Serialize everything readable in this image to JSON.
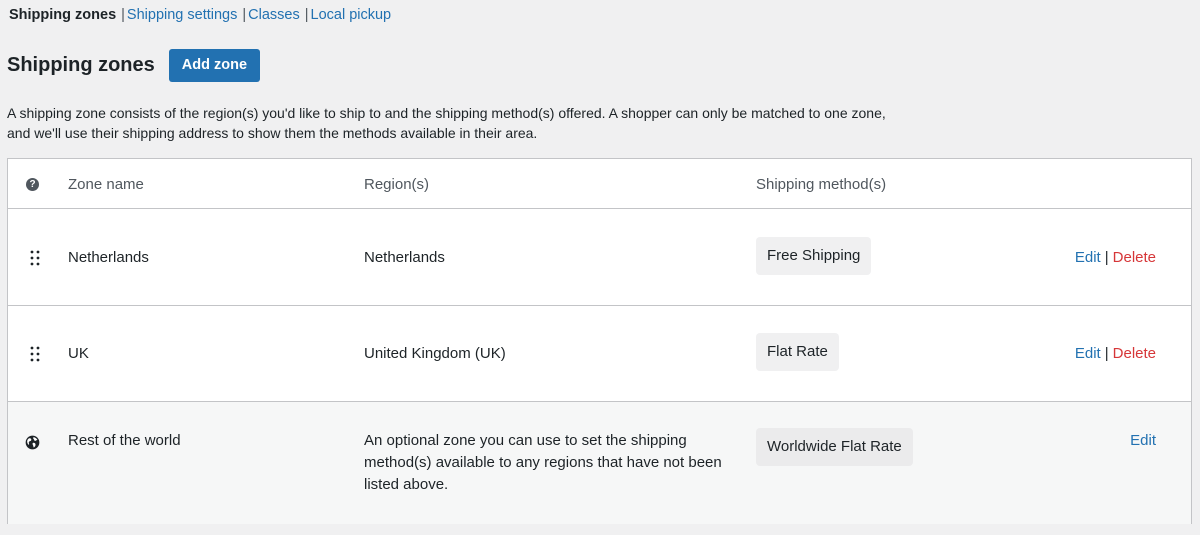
{
  "subnav": {
    "current": "Shipping zones",
    "links": [
      "Shipping settings",
      "Classes",
      "Local pickup"
    ]
  },
  "header": {
    "title": "Shipping zones",
    "add_zone_label": "Add zone"
  },
  "description": "A shipping zone consists of the region(s) you'd like to ship to and the shipping method(s) offered. A shopper can only be matched to one zone, and we'll use their shipping address to show them the methods available in their area.",
  "table": {
    "help_glyph": "?",
    "columns": {
      "name": "Zone name",
      "regions": "Region(s)",
      "methods": "Shipping method(s)"
    },
    "rows": [
      {
        "name": "Netherlands",
        "regions": "Netherlands",
        "method": "Free Shipping",
        "edit": "Edit",
        "separator": "|",
        "delete": "Delete"
      },
      {
        "name": "UK",
        "regions": "United Kingdom (UK)",
        "method": "Flat Rate",
        "edit": "Edit",
        "separator": "|",
        "delete": "Delete"
      },
      {
        "name": "Rest of the world",
        "regions": "An optional zone you can use to set the shipping method(s) available to any regions that have not been listed above.",
        "method": "Worldwide Flat Rate",
        "edit": "Edit"
      }
    ]
  },
  "colors": {
    "link": "#2271b1",
    "delete": "#d63638",
    "button": "#2271b1",
    "page_bg": "#f0f0f1"
  },
  "icons": {
    "help": "help-icon",
    "drag": "drag-handle-icon",
    "globe": "globe-icon"
  }
}
